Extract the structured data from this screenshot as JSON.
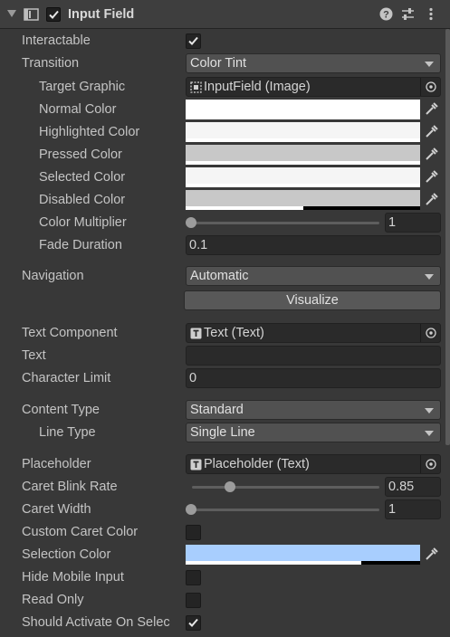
{
  "component": {
    "title": "Input Field",
    "enabled": true
  },
  "icons": {
    "collapse": "triangle-down",
    "component": "input-field-icon",
    "help": "help-icon",
    "presets": "sliders-icon",
    "menu": "kebab-menu-icon"
  },
  "fields": {
    "interactable": {
      "label": "Interactable",
      "checked": true
    },
    "transition": {
      "label": "Transition",
      "value": "Color Tint"
    },
    "target_graphic": {
      "label": "Target Graphic",
      "value": "InputField (Image)"
    },
    "normal_color": {
      "label": "Normal Color",
      "color": "#ffffff",
      "alpha": 1.0
    },
    "highlighted_color": {
      "label": "Highlighted Color",
      "color": "#f5f5f5",
      "alpha": 1.0
    },
    "pressed_color": {
      "label": "Pressed Color",
      "color": "#c8c8c8",
      "alpha": 1.0
    },
    "selected_color": {
      "label": "Selected Color",
      "color": "#f5f5f5",
      "alpha": 1.0
    },
    "disabled_color": {
      "label": "Disabled Color",
      "color": "#c8c8c8",
      "alpha": 0.5
    },
    "color_multiplier": {
      "label": "Color Multiplier",
      "value": "1",
      "slider_fraction": 0.0
    },
    "fade_duration": {
      "label": "Fade Duration",
      "value": "0.1"
    },
    "navigation": {
      "label": "Navigation",
      "value": "Automatic"
    },
    "visualize": {
      "label": "Visualize"
    },
    "text_component": {
      "label": "Text Component",
      "value": "Text (Text)"
    },
    "text": {
      "label": "Text",
      "value": ""
    },
    "character_limit": {
      "label": "Character Limit",
      "value": "0"
    },
    "content_type": {
      "label": "Content Type",
      "value": "Standard"
    },
    "line_type": {
      "label": "Line Type",
      "value": "Single Line"
    },
    "placeholder": {
      "label": "Placeholder",
      "value": "Placeholder (Text)"
    },
    "caret_blink_rate": {
      "label": "Caret Blink Rate",
      "value": "0.85",
      "slider_fraction": 0.21
    },
    "caret_width": {
      "label": "Caret Width",
      "value": "1",
      "slider_fraction": 0.0
    },
    "custom_caret_color": {
      "label": "Custom Caret Color",
      "checked": false
    },
    "selection_color": {
      "label": "Selection Color",
      "color": "#a8cefe",
      "alpha": 0.75
    },
    "hide_mobile_input": {
      "label": "Hide Mobile Input",
      "checked": false
    },
    "read_only": {
      "label": "Read Only",
      "checked": false
    },
    "should_activate_on_select": {
      "label": "Should Activate On Selec",
      "checked": true
    }
  }
}
